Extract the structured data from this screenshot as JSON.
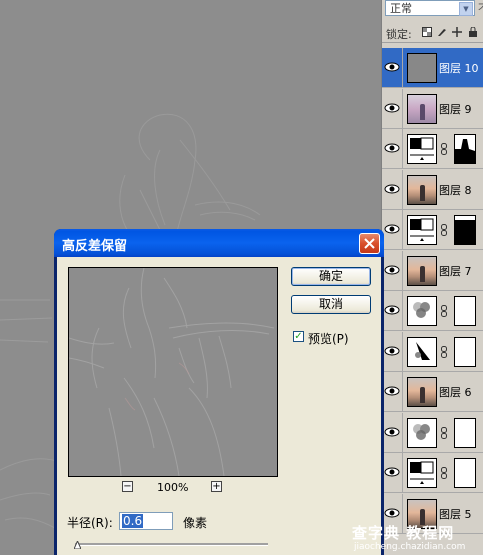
{
  "layers_panel": {
    "blend_mode": "正常",
    "extra_char": "不",
    "lock_label": "锁定:",
    "layers": [
      {
        "name": "图层 10",
        "type": "gray",
        "selected": true
      },
      {
        "name": "图层 9",
        "type": "photo2",
        "selected": false
      },
      {
        "name": "",
        "type": "adjustment-levels",
        "selected": false
      },
      {
        "name": "图层 8",
        "type": "photo",
        "selected": false
      },
      {
        "name": "",
        "type": "adjustment-levels",
        "selected": false
      },
      {
        "name": "图层 7",
        "type": "photo",
        "selected": false
      },
      {
        "name": "",
        "type": "adjustment-hue",
        "selected": false
      },
      {
        "name": "",
        "type": "adjustment-curves",
        "selected": false
      },
      {
        "name": "图层 6",
        "type": "photo",
        "selected": false
      },
      {
        "name": "",
        "type": "adjustment-hue",
        "selected": false
      },
      {
        "name": "",
        "type": "adjustment-levels",
        "selected": false
      },
      {
        "name": "图层 5",
        "type": "photo",
        "selected": false
      }
    ]
  },
  "dialog": {
    "title": "高反差保留",
    "ok_label": "确定",
    "cancel_label": "取消",
    "preview_label": "预览(P)",
    "preview_checked": true,
    "zoom_level": "100%",
    "zoom_out": "−",
    "zoom_in": "+",
    "radius_label": "半径(R):",
    "radius_value": "0.6",
    "radius_unit": "像素",
    "radius_slider_level": 0.0
  },
  "watermark": {
    "main": "查字典 教程网",
    "url": "jiaocheng.chazidian.com"
  }
}
